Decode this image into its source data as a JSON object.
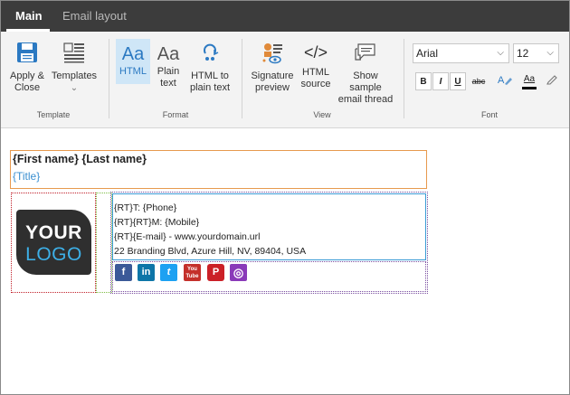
{
  "tabs": [
    {
      "label": "Main",
      "active": true
    },
    {
      "label": "Email layout",
      "active": false
    }
  ],
  "ribbon": {
    "template_group": {
      "label": "Template",
      "apply_close": {
        "label_1": "Apply &",
        "label_2": "Close",
        "icon": "save-icon"
      },
      "templates": {
        "label": "Templates",
        "icon": "templates-icon",
        "chevron": "⌄"
      }
    },
    "format_group": {
      "label": "Format",
      "html": {
        "label": "HTML",
        "glyph": "Aa",
        "selected": true
      },
      "plain_text": {
        "label_1": "Plain",
        "label_2": "text",
        "glyph": "Aa"
      },
      "html_to_plain": {
        "label_1": "HTML to",
        "label_2": "plain text",
        "icon": "html-to-plain-icon"
      }
    },
    "view_group": {
      "label": "View",
      "signature_preview": {
        "label_1": "Signature",
        "label_2": "preview",
        "icon": "signature-preview-icon"
      },
      "html_source": {
        "label_1": "HTML",
        "label_2": "source",
        "glyph": "</>"
      },
      "show_thread": {
        "label_1": "Show sample",
        "label_2": "email thread",
        "icon": "email-thread-icon"
      }
    },
    "font_group": {
      "label": "Font",
      "font_family": "Arial",
      "font_size": "12",
      "bold": "B",
      "italic": "I",
      "underline": "U",
      "strike": "abc",
      "font_color_glyph": "Aa"
    }
  },
  "signature": {
    "name_line": "{First name} {Last name}",
    "title_line": "{Title}",
    "logo_top": "YOUR",
    "logo_bottom": "LOGO",
    "contact_lines": [
      "{RT}T: {Phone}",
      "{RT}{RT}M: {Mobile}",
      "{RT}{E-mail} - www.yourdomain.url",
      "22 Branding Blvd, Azure Hill, NV, 89404, USA"
    ],
    "social": [
      {
        "name": "facebook",
        "glyph": "f",
        "color": "#3b5998"
      },
      {
        "name": "linkedin",
        "glyph": "in",
        "color": "#0e76a8"
      },
      {
        "name": "twitter",
        "glyph": "t",
        "color": "#1da1f2"
      },
      {
        "name": "youtube",
        "glyph": "You Tube",
        "color": "#c4302b"
      },
      {
        "name": "pinterest",
        "glyph": "P",
        "color": "#cb2027"
      },
      {
        "name": "instagram",
        "glyph": "◎",
        "color": "#8a3ab9"
      }
    ]
  },
  "colors": {
    "tab_bar": "#3c3c3c",
    "ribbon": "#f3f3f3",
    "accent_blue": "#2b79c2",
    "title_blue": "#3a8fd0"
  }
}
